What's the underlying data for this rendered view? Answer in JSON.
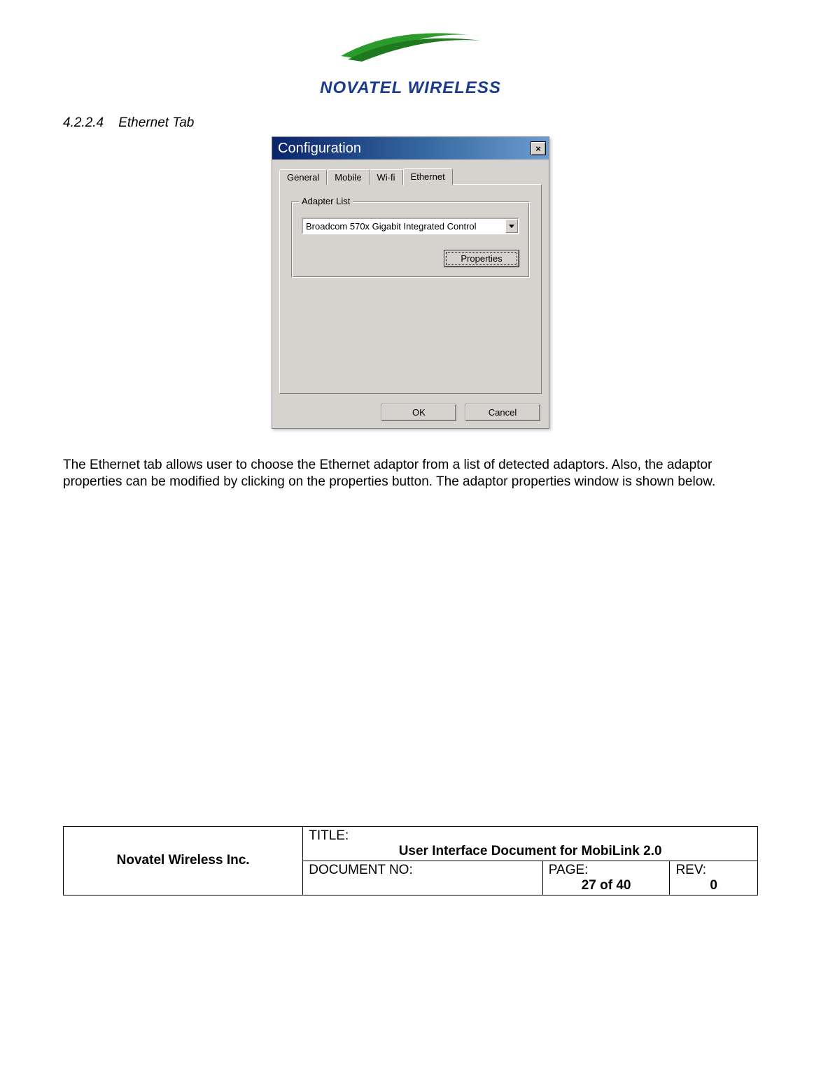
{
  "logo": {
    "text": "NOVATEL WIRELESS"
  },
  "section": {
    "number": "4.2.2.4",
    "title": "Ethernet Tab"
  },
  "dialog": {
    "title": "Configuration",
    "close": "×",
    "tabs": {
      "general": "General",
      "mobile": "Mobile",
      "wifi": "Wi-fi",
      "ethernet": "Ethernet"
    },
    "group_label": "Adapter List",
    "combo_value": "Broadcom 570x Gigabit Integrated Control",
    "properties_btn": "Properties",
    "ok_btn": "OK",
    "cancel_btn": "Cancel"
  },
  "body_text": "The Ethernet tab allows user to choose the Ethernet adaptor from a list of detected adaptors.  Also, the adaptor properties can be modified by clicking on the properties button.  The adaptor properties window is shown below.",
  "footer": {
    "company": "Novatel Wireless Inc.",
    "title_label": "TITLE:",
    "title_value": "User Interface Document for MobiLink 2.0",
    "docno_label": "DOCUMENT NO:",
    "docno_value": "",
    "page_label": "PAGE:",
    "page_value": "27 of 40",
    "rev_label": "REV:",
    "rev_value": "0"
  }
}
